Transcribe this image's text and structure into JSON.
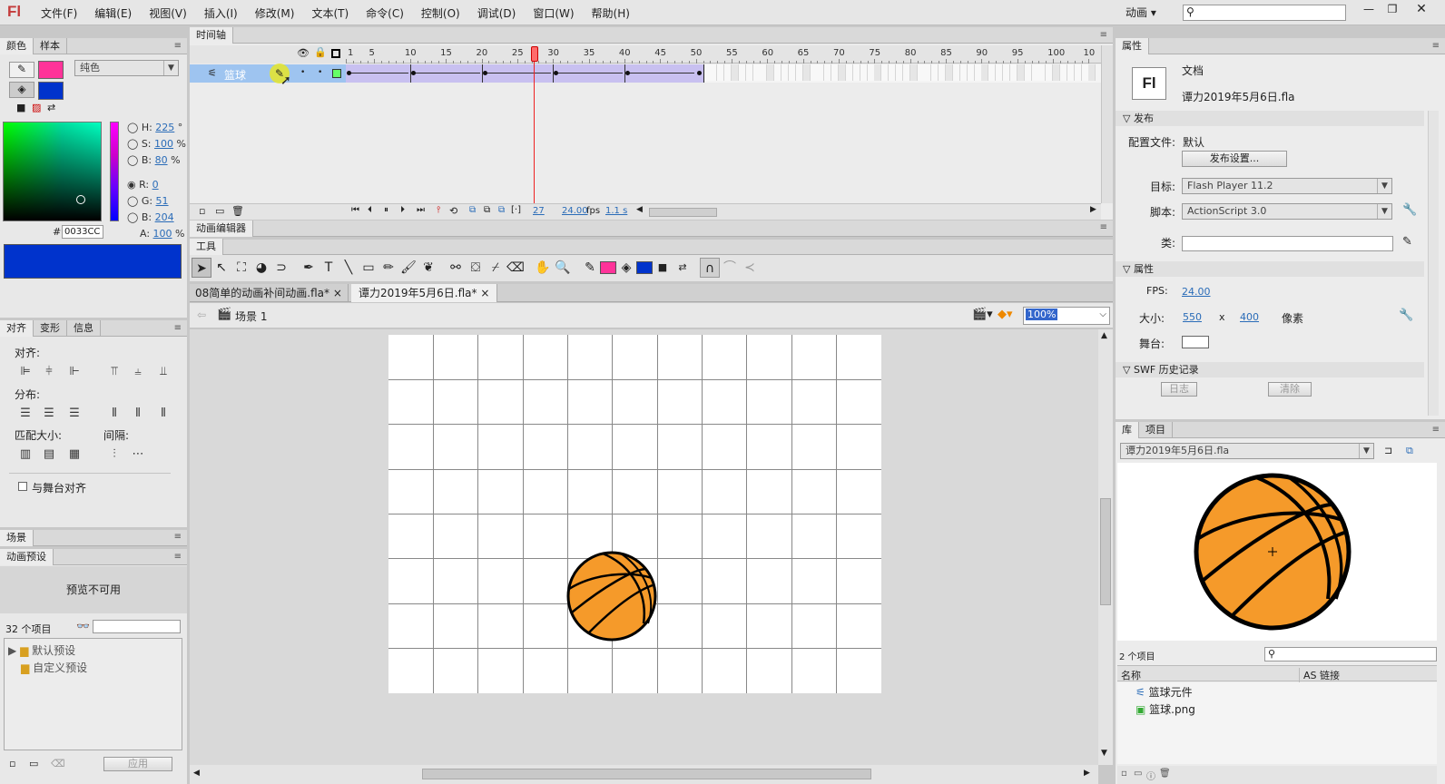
{
  "app": {
    "logo": "Fl",
    "menus": [
      "文件(F)",
      "编辑(E)",
      "视图(V)",
      "插入(I)",
      "修改(M)",
      "文本(T)",
      "命令(C)",
      "控制(O)",
      "调试(D)",
      "窗口(W)",
      "帮助(H)"
    ],
    "workspace": "动画",
    "search_placeholder": ""
  },
  "color_panel": {
    "tabs": [
      "颜色",
      "样本"
    ],
    "fill_type": "纯色",
    "stroke_color": "#ff3399",
    "fill_color": "#0033cc",
    "hsb": {
      "h_label": "H:",
      "h": "225",
      "h_unit": "°",
      "s_label": "S:",
      "s": "100",
      "s_unit": "%",
      "b_label": "B:",
      "b": "80",
      "b_unit": "%"
    },
    "rgb": {
      "r_label": "R:",
      "r": "0",
      "g_label": "G:",
      "g": "51",
      "b_label": "B:",
      "b": "204"
    },
    "alpha_label": "A:",
    "alpha": "100",
    "alpha_unit": "%",
    "hex_label": "#",
    "hex": "0033CC"
  },
  "align_panel": {
    "tabs": [
      "对齐",
      "变形",
      "信息"
    ],
    "align_label": "对齐:",
    "distribute_label": "分布:",
    "match_size_label": "匹配大小:",
    "spacing_label": "间隔:",
    "stage_align_label": "与舞台对齐"
  },
  "scene_panel": {
    "tab": "场景"
  },
  "motion_presets": {
    "tab": "动画预设",
    "preview": "预览不可用",
    "count": "32 个项目",
    "folders": [
      "默认预设",
      "自定义预设"
    ],
    "apply_label": "应用"
  },
  "timeline": {
    "tab": "时间轴",
    "layer_name": "篮球",
    "ruler": [
      "1",
      "5",
      "10",
      "15",
      "20",
      "25",
      "30",
      "35",
      "40",
      "45",
      "50",
      "55",
      "60",
      "65",
      "70",
      "75",
      "80",
      "85",
      "90",
      "95",
      "100",
      "10"
    ],
    "current_frame": "27",
    "fps": "24.00",
    "fps_unit": "fps",
    "time": "1.1 s"
  },
  "motion_editor": {
    "tab": "动画编辑器"
  },
  "tools": {
    "header": "工具"
  },
  "docs": {
    "tabs": [
      "08简单的动画补间动画.fla*",
      "谭力2019年5月6日.fla*"
    ],
    "scene": "场景 1",
    "zoom": "100%"
  },
  "properties": {
    "tab": "属性",
    "doc_type": "文档",
    "doc_name": "谭力2019年5月6日.fla",
    "publish_section": "发布",
    "profile_label": "配置文件:",
    "profile_value": "默认",
    "publish_settings": "发布设置...",
    "target_label": "目标:",
    "target_value": "Flash Player 11.2",
    "script_label": "脚本:",
    "script_value": "ActionScript 3.0",
    "class_label": "类:",
    "attr_section": "属性",
    "fps_label": "FPS:",
    "fps": "24.00",
    "size_label": "大小:",
    "width": "550",
    "x": "x",
    "height": "400",
    "units": "像素",
    "stage_label": "舞台:",
    "stage_color": "#ffffff",
    "swf_section": "SWF 历史记录",
    "log_label": "日志",
    "clear_label": "清除"
  },
  "library": {
    "tabs": [
      "库",
      "项目"
    ],
    "file": "谭力2019年5月6日.fla",
    "count": "2 个项目",
    "col_name": "名称",
    "col_link": "AS 链接",
    "items": [
      "篮球元件",
      "篮球.png"
    ]
  }
}
